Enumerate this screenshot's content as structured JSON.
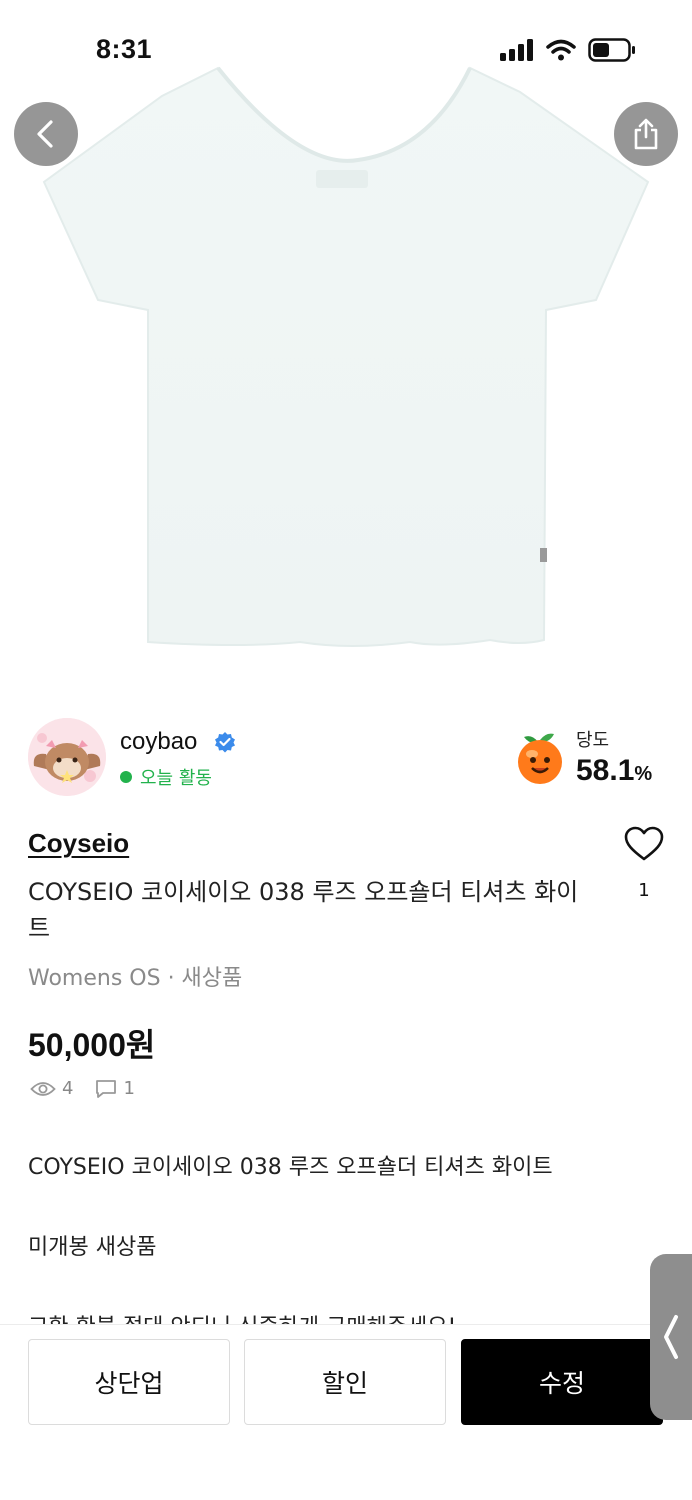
{
  "status_bar": {
    "time": "8:31"
  },
  "seller": {
    "name": "coybao",
    "activity": "오늘 활동",
    "sweetness_label": "당도",
    "sweetness_value": "58.1",
    "sweetness_unit": "%"
  },
  "product": {
    "brand": "Coyseio",
    "title": "COYSEIO 코이세이오 038 루즈 오프숄더 티셔츠 화이트",
    "meta": "Womens OS · 새상품",
    "price": "50,000원",
    "views": "4",
    "chats": "1",
    "likes": "1"
  },
  "description": {
    "lines": [
      "COYSEIO 코이세이오 038 루즈 오프숄더 티셔츠 화이트",
      "미개봉 새상품",
      "교환,환불 절대 안되니 신중하게 구매해주세요!"
    ]
  },
  "bottom_bar": {
    "btn_bump": "상단업",
    "btn_discount": "할인",
    "btn_edit": "수정"
  },
  "colors": {
    "accent_green": "#22b24c",
    "verified_blue": "#3b8beb",
    "primary_button": "#000000"
  },
  "icons": [
    "back-arrow-icon",
    "share-icon",
    "verified-badge-icon",
    "peach-icon",
    "heart-icon",
    "eye-icon",
    "chat-icon",
    "chevron-left-icon"
  ]
}
